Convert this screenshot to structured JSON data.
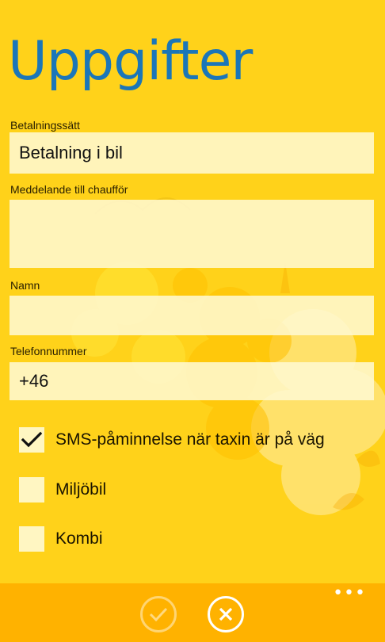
{
  "page": {
    "title": "Uppgifter"
  },
  "form": {
    "payment": {
      "label": "Betalningssätt",
      "value": "Betalning i bil"
    },
    "message": {
      "label": "Meddelande till chaufför",
      "value": ""
    },
    "name": {
      "label": "Namn",
      "value": ""
    },
    "phone": {
      "label": "Telefonnummer",
      "value": "+46"
    }
  },
  "options": [
    {
      "label": "SMS-påminnelse när taxin är på väg",
      "checked": true
    },
    {
      "label": "Miljöbil",
      "checked": false
    },
    {
      "label": "Kombi",
      "checked": false
    }
  ],
  "appbar": {
    "buttons": [
      {
        "icon": "check-icon",
        "enabled": false
      },
      {
        "icon": "close-icon",
        "enabled": true
      }
    ],
    "more_icon": "more-icon"
  },
  "colors": {
    "background": "#ffd21a",
    "title": "#1b76b8",
    "appbar": "#ffb200",
    "field": "#fff8d0"
  }
}
